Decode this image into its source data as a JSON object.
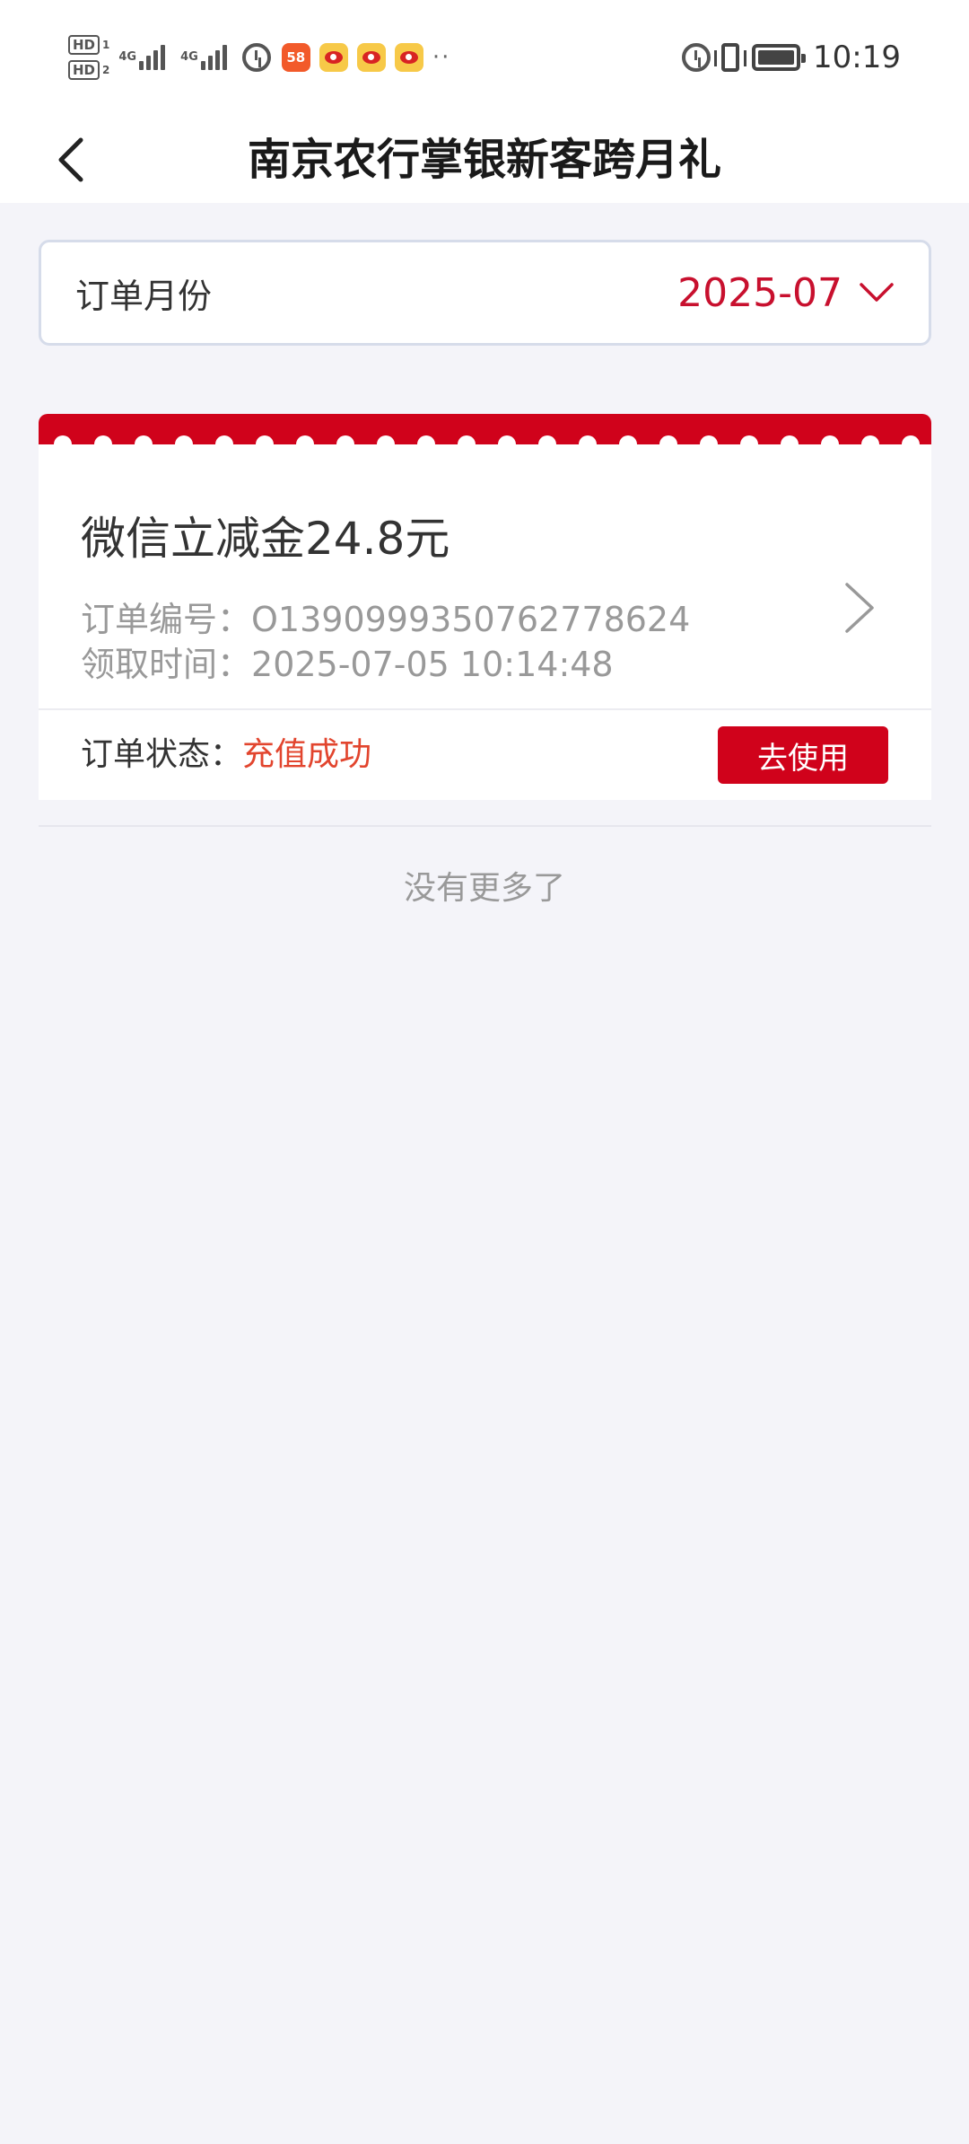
{
  "status_bar": {
    "hd1": "HD",
    "hd1_num": "1",
    "hd2": "HD",
    "hd2_num": "2",
    "signal1_label": "4G",
    "signal2_label": "4G",
    "app_icon_text": "58",
    "dots": "··",
    "time": "10:19"
  },
  "nav": {
    "title": "南京农行掌银新客跨月礼"
  },
  "month_selector": {
    "label": "订单月份",
    "value": "2025-07"
  },
  "order": {
    "name": "微信立减金24.8元",
    "number_label": "订单编号：",
    "number_value": "O1390999350762778624",
    "time_label": "领取时间：",
    "time_value": "2025-07-05 10:14:48",
    "status_label": "订单状态：",
    "status_value": "充值成功",
    "action_label": "去使用"
  },
  "list_footer": {
    "no_more": "没有更多了"
  },
  "colors": {
    "accent_red": "#d0021b",
    "status_orange_red": "#e2452e",
    "month_red": "#c8102e",
    "page_bg": "#f4f4f9"
  }
}
